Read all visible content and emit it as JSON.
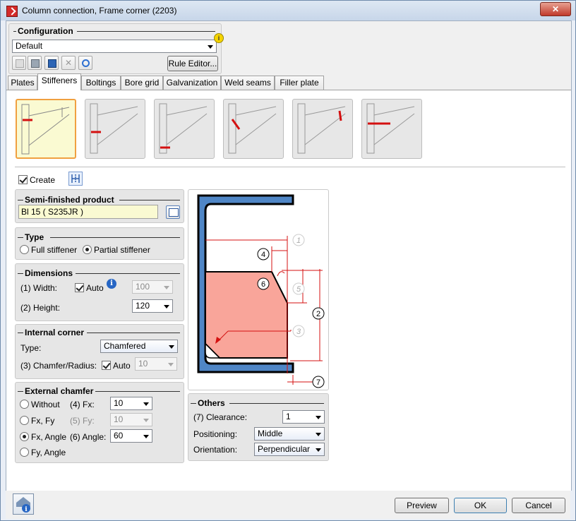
{
  "window": {
    "title": "Column connection, Frame corner (2203)",
    "close_glyph": "✕"
  },
  "configuration": {
    "heading": "Configuration",
    "selected": "Default",
    "rule_editor_label": "Rule Editor..."
  },
  "tabs": [
    {
      "label": "Plates"
    },
    {
      "label": "Stiffeners"
    },
    {
      "label": "Boltings"
    },
    {
      "label": "Bore grid"
    },
    {
      "label": "Galvanization"
    },
    {
      "label": "Weld seams"
    },
    {
      "label": "Filler plate"
    }
  ],
  "create": {
    "label": "Create",
    "checked": true
  },
  "semi_finished": {
    "heading": "Semi-finished product",
    "value": "Bl 15  ( S235JR )"
  },
  "type": {
    "heading": "Type",
    "full_label": "Full stiffener",
    "partial_label": "Partial stiffener",
    "selected": "partial"
  },
  "dimensions": {
    "heading": "Dimensions",
    "width_label": "(1) Width:",
    "auto_label": "Auto",
    "width_value": "100",
    "height_label": "(2) Height:",
    "height_value": "120"
  },
  "internal_corner": {
    "heading": "Internal corner",
    "type_label": "Type:",
    "type_value": "Chamfered",
    "chamfer_label": "(3) Chamfer/Radius:",
    "auto_label": "Auto",
    "chamfer_value": "10"
  },
  "external_chamfer": {
    "heading": "External chamfer",
    "without_label": "Without",
    "fxfy_label": "Fx, Fy",
    "fxangle_label": "Fx, Angle",
    "fyangle_label": "Fy, Angle",
    "fx_label": "(4) Fx:",
    "fx_value": "10",
    "fy_label": "(5) Fy:",
    "fy_value": "10",
    "angle_label": "(6) Angle:",
    "angle_value": "60",
    "selected": "fx-angle"
  },
  "others": {
    "heading": "Others",
    "clearance_label": "(7) Clearance:",
    "clearance_value": "1",
    "positioning_label": "Positioning:",
    "positioning_value": "Middle",
    "orientation_label": "Orientation:",
    "orientation_value": "Perpendicular"
  },
  "diagram": {
    "labels": [
      "1",
      "2",
      "3",
      "4",
      "5",
      "6",
      "7"
    ]
  },
  "buttons": {
    "preview": "Preview",
    "ok": "OK",
    "cancel": "Cancel"
  },
  "colors": {
    "accent_active": "#f0a040",
    "stiffener_fill": "#f9a59a",
    "profile_fill": "#4f86c6",
    "dim_red": "#d41010"
  }
}
